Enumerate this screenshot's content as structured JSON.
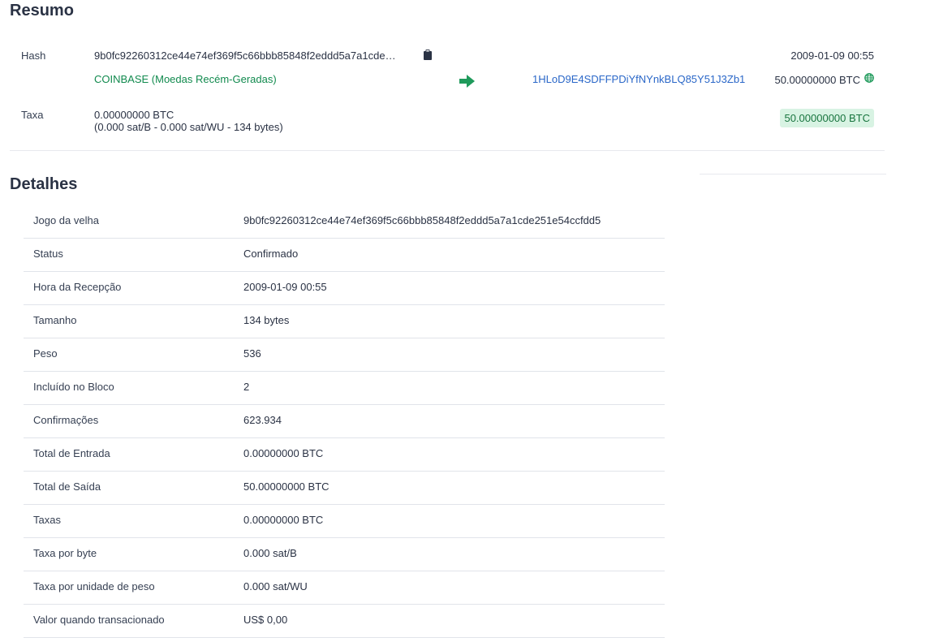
{
  "summary": {
    "title": "Resumo",
    "hash_label": "Hash",
    "hash_value": "9b0fc92260312ce44e74ef369f5c66bbb85848f2eddd5a7a1cde…",
    "timestamp": "2009-01-09 00:55",
    "input_source": "COINBASE (Moedas Recém-Geradas)",
    "output_address": "1HLoD9E4SDFFPDiYfNYnkBLQ85Y51J3Zb1",
    "output_amount": "50.00000000 BTC",
    "fee_label": "Taxa",
    "fee_value": "0.00000000 BTC",
    "fee_detail": "(0.000 sat/B - 0.000 sat/WU - 134 bytes)",
    "total_badge": "50.00000000 BTC",
    "icons": {
      "copy": "clipboard-icon",
      "arrow": "arrow-right-icon",
      "globe": "globe-icon"
    },
    "colors": {
      "green": "#118a4e",
      "link": "#2a67c8",
      "badge_bg": "#d8f3e3"
    }
  },
  "details": {
    "title": "Detalhes",
    "rows": [
      {
        "label": "Jogo da velha",
        "value": "9b0fc92260312ce44e74ef369f5c66bbb85848f2eddd5a7a1cde251e54ccfdd5",
        "style": ""
      },
      {
        "label": "Status",
        "value": "Confirmado",
        "style": "green"
      },
      {
        "label": "Hora da Recepção",
        "value": "2009-01-09 00:55",
        "style": ""
      },
      {
        "label": "Tamanho",
        "value": "134 bytes",
        "style": ""
      },
      {
        "label": "Peso",
        "value": "536",
        "style": ""
      },
      {
        "label": "Incluído no Bloco",
        "value": "2",
        "style": "link"
      },
      {
        "label": "Confirmações",
        "value": "623.934",
        "style": ""
      },
      {
        "label": "Total de Entrada",
        "value": "0.00000000 BTC",
        "style": ""
      },
      {
        "label": "Total de Saída",
        "value": "50.00000000 BTC",
        "style": ""
      },
      {
        "label": "Taxas",
        "value": "0.00000000 BTC",
        "style": ""
      },
      {
        "label": "Taxa por byte",
        "value": "0.000 sat/B",
        "style": ""
      },
      {
        "label": "Taxa por unidade de peso",
        "value": "0.000 sat/WU",
        "style": ""
      },
      {
        "label": "Valor quando transacionado",
        "value": "US$ 0,00",
        "style": ""
      }
    ]
  }
}
